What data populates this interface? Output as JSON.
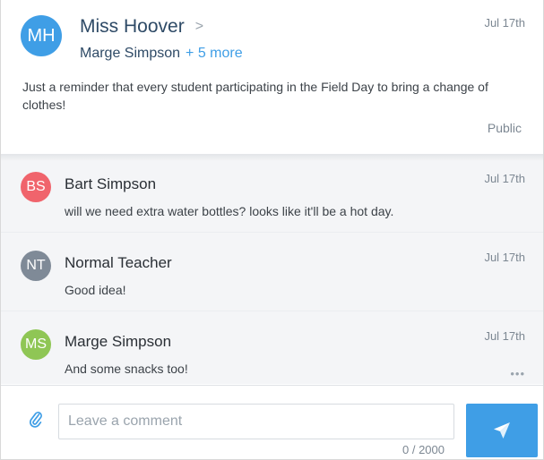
{
  "post": {
    "avatar_initials": "MH",
    "avatar_color": "#3f9ee6",
    "author": "Miss Hoover",
    "chevron": ">",
    "recipient": "Marge Simpson",
    "recipient_more": "+ 5 more",
    "date": "Jul 17th",
    "body": "Just a reminder that every student participating in the Field Day to bring a change of clothes!",
    "visibility": "Public"
  },
  "comments": [
    {
      "initials": "BS",
      "color": "#f0646c",
      "name": "Bart Simpson",
      "date": "Jul 17th",
      "text": "will we need extra water bottles? looks like it'll be a hot day."
    },
    {
      "initials": "NT",
      "color": "#7f8a97",
      "name": "Normal Teacher",
      "date": "Jul 17th",
      "text": "Good idea!"
    },
    {
      "initials": "MS",
      "color": "#8fc655",
      "name": "Marge Simpson",
      "date": "Jul 17th",
      "text": "And some snacks too!",
      "more_icon": "•••"
    }
  ],
  "composer": {
    "placeholder": "Leave a comment",
    "char_count": "0 / 2000",
    "attach_icon": "paperclip-icon",
    "send_icon": "paper-plane-icon",
    "accent": "#3f9ee6"
  }
}
